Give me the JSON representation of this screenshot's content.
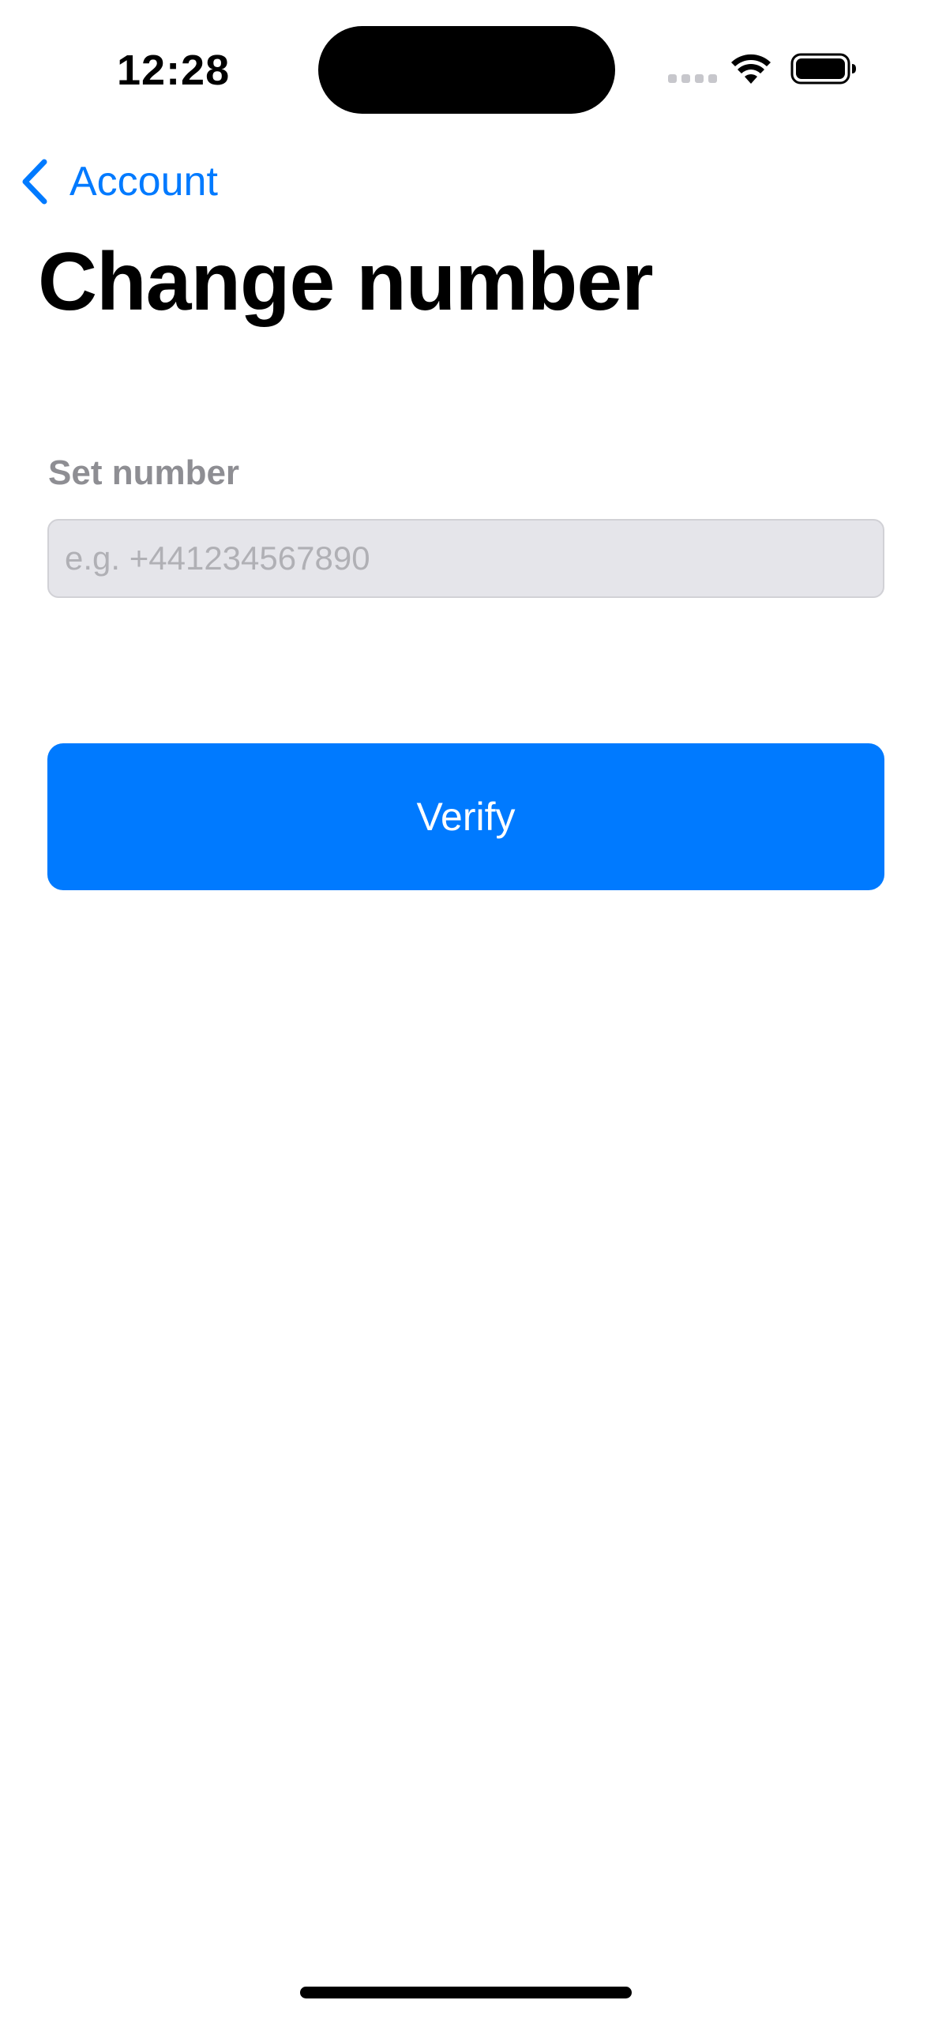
{
  "status_bar": {
    "time": "12:28",
    "icons": [
      "signal-dots-icon",
      "wifi-icon",
      "battery-icon"
    ]
  },
  "nav": {
    "back_label": "Account",
    "back_icon": "chevron-left-icon"
  },
  "page": {
    "title": "Change number"
  },
  "form": {
    "label": "Set number",
    "input_value": "",
    "input_placeholder": "e.g. +441234567890",
    "submit_label": "Verify"
  },
  "colors": {
    "accent": "#007aff",
    "label_gray": "#8e8e93",
    "input_bg": "#e5e5ea",
    "placeholder": "#b0b0b5"
  }
}
